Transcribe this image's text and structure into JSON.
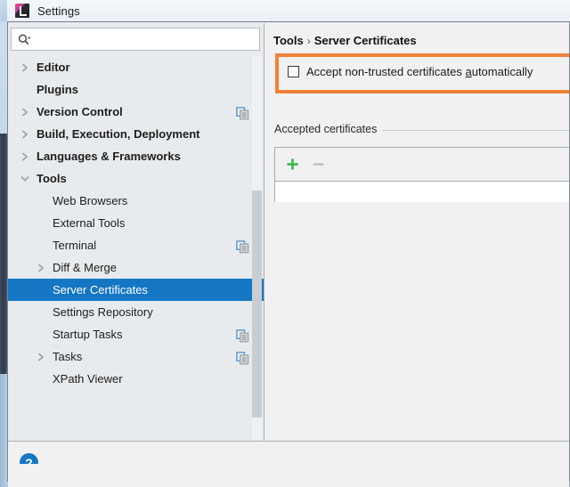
{
  "window": {
    "title": "Settings",
    "app_icon": "intellij-idea-icon"
  },
  "search": {
    "placeholder": "",
    "value": "",
    "icon": "search-icon",
    "dropdown_icon": "chevron-down-icon"
  },
  "sidebar": {
    "items": [
      {
        "label": "Editor",
        "level": 0,
        "arrow": "chevron-right",
        "selected": false,
        "dup_icon": false
      },
      {
        "label": "Plugins",
        "level": 0,
        "arrow": "none",
        "selected": false,
        "dup_icon": false
      },
      {
        "label": "Version Control",
        "level": 0,
        "arrow": "chevron-right",
        "selected": false,
        "dup_icon": true
      },
      {
        "label": "Build, Execution, Deployment",
        "level": 0,
        "arrow": "chevron-right",
        "selected": false,
        "dup_icon": false
      },
      {
        "label": "Languages & Frameworks",
        "level": 0,
        "arrow": "chevron-right",
        "selected": false,
        "dup_icon": false
      },
      {
        "label": "Tools",
        "level": 0,
        "arrow": "chevron-down",
        "selected": false,
        "dup_icon": false
      },
      {
        "label": "Web Browsers",
        "level": 1,
        "arrow": "none",
        "selected": false,
        "dup_icon": false
      },
      {
        "label": "External Tools",
        "level": 1,
        "arrow": "none",
        "selected": false,
        "dup_icon": false
      },
      {
        "label": "Terminal",
        "level": 1,
        "arrow": "none",
        "selected": false,
        "dup_icon": true
      },
      {
        "label": "Diff & Merge",
        "level": 1,
        "arrow": "chevron-right",
        "selected": false,
        "dup_icon": false
      },
      {
        "label": "Server Certificates",
        "level": 1,
        "arrow": "none",
        "selected": true,
        "dup_icon": false
      },
      {
        "label": "Settings Repository",
        "level": 1,
        "arrow": "none",
        "selected": false,
        "dup_icon": false
      },
      {
        "label": "Startup Tasks",
        "level": 1,
        "arrow": "none",
        "selected": false,
        "dup_icon": true
      },
      {
        "label": "Tasks",
        "level": 1,
        "arrow": "chevron-right",
        "selected": false,
        "dup_icon": true
      },
      {
        "label": "XPath Viewer",
        "level": 1,
        "arrow": "none",
        "selected": false,
        "dup_icon": false
      }
    ],
    "help_button_label": "?"
  },
  "main": {
    "breadcrumb": {
      "parent": "Tools",
      "separator": "›",
      "current": "Server Certificates"
    },
    "accept_setting": {
      "label_prefix": "Accept non-trusted certificates ",
      "label_mnemonic": "a",
      "label_suffix": "utomatically",
      "checked": false,
      "highlight_color": "#f08137"
    },
    "accepted_certificates": {
      "group_title": "Accepted certificates",
      "add_button_label": "+",
      "remove_button_label": "−",
      "add_color": "#3bb54a",
      "remove_color": "#b9bcc0",
      "rows": []
    }
  },
  "colors": {
    "selection": "#1577c4",
    "panel": "#f1f1f1",
    "tree_background": "#e7ebee",
    "accent_orange": "#f08137"
  }
}
